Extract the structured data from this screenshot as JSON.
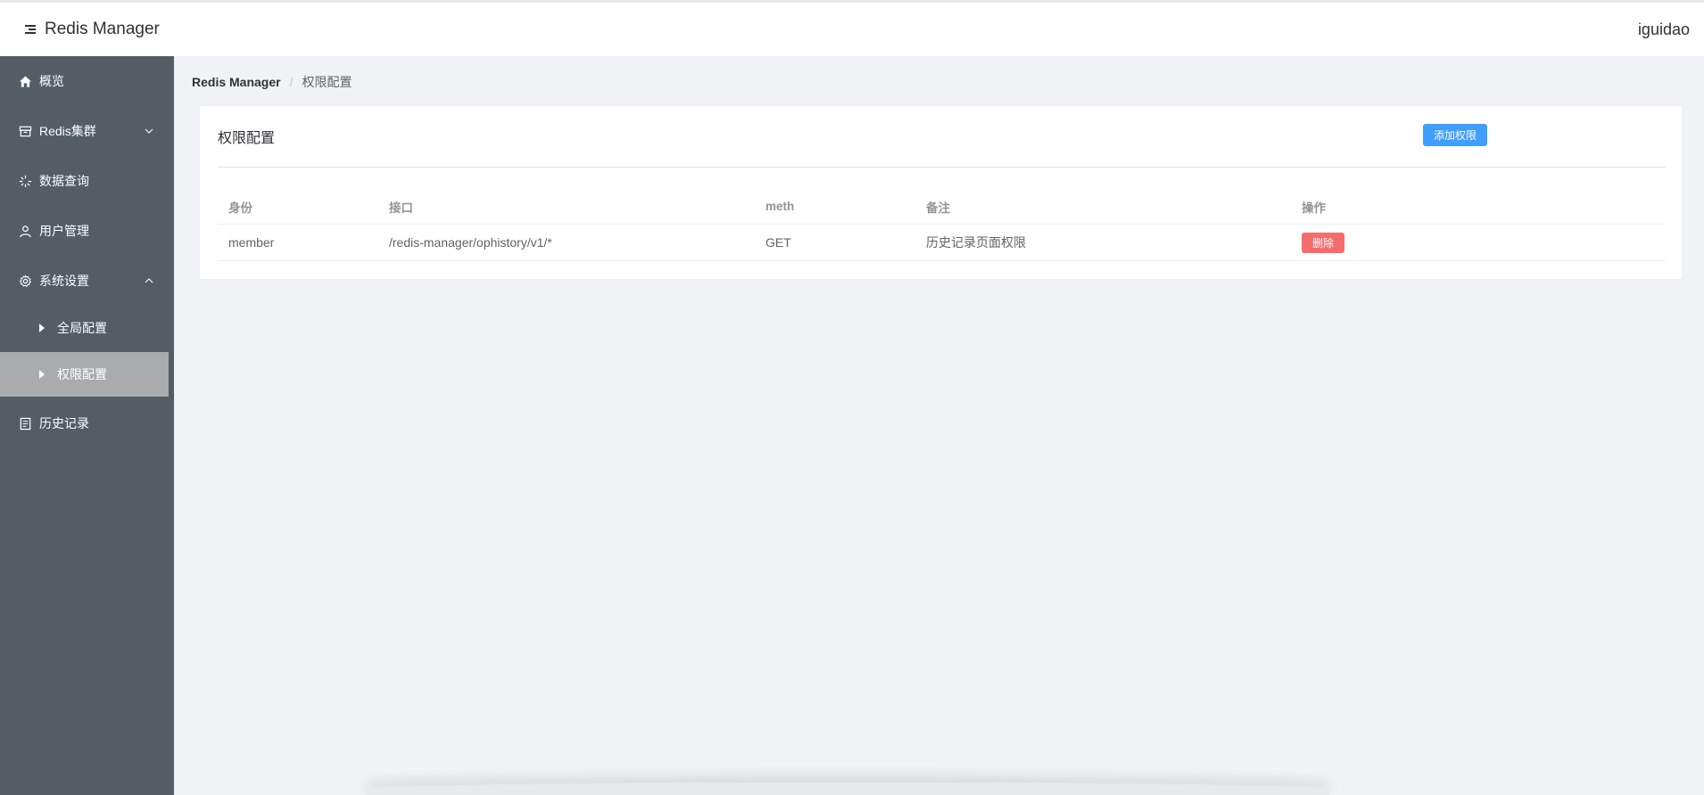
{
  "header": {
    "app_title": "Redis Manager",
    "username": "iguidao"
  },
  "sidebar": {
    "items": [
      {
        "label": "概览",
        "icon": "home-icon"
      },
      {
        "label": "Redis集群",
        "icon": "archive-icon",
        "expanded": false
      },
      {
        "label": "数据查询",
        "icon": "loading-icon"
      },
      {
        "label": "用户管理",
        "icon": "user-icon"
      },
      {
        "label": "系统设置",
        "icon": "gear-icon",
        "expanded": true,
        "children": [
          {
            "label": "全局配置"
          },
          {
            "label": "权限配置",
            "active": true
          }
        ]
      },
      {
        "label": "历史记录",
        "icon": "document-icon"
      }
    ]
  },
  "breadcrumb": {
    "root": "Redis Manager",
    "separator": "/",
    "current": "权限配置"
  },
  "card": {
    "title": "权限配置",
    "add_button": "添加权限"
  },
  "table": {
    "columns": [
      "身份",
      "接口",
      "meth",
      "备注",
      "操作"
    ],
    "rows": [
      {
        "identity": "member",
        "api": "/redis-manager/ophistory/v1/*",
        "method": "GET",
        "note": "历史记录页面权限",
        "action": "删除"
      }
    ]
  },
  "colors": {
    "sidebar_bg": "#545c64",
    "sidebar_active_bg": "#a9abad",
    "primary": "#409eff",
    "danger": "#f56c6c",
    "page_bg": "#f0f2f5"
  }
}
